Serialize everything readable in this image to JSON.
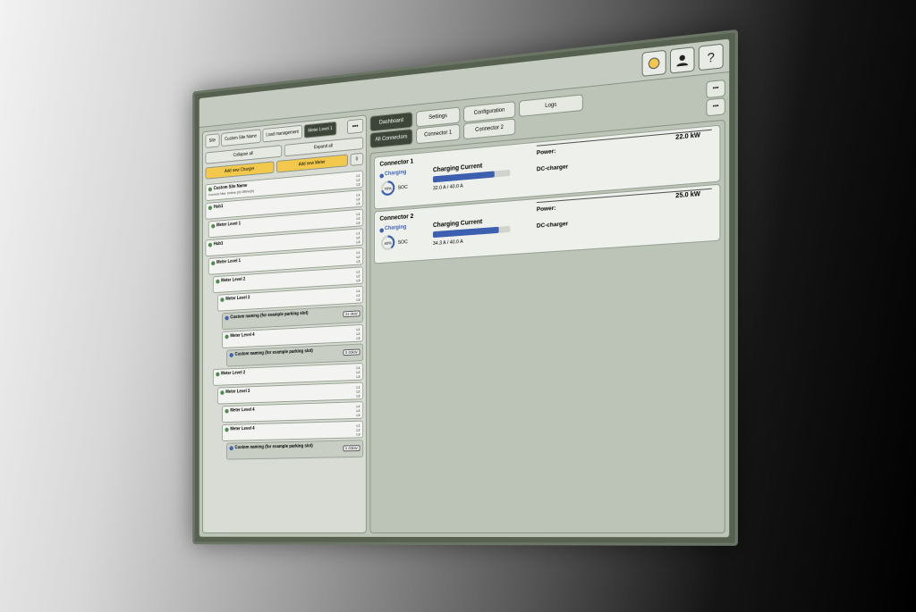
{
  "topbar": {
    "icons": [
      "charger-icon",
      "user-icon",
      "help-icon"
    ],
    "help_glyph": "?"
  },
  "left": {
    "crumbs": [
      "Site",
      "Custom Site Name",
      "Load management",
      "Meter Level 1"
    ],
    "actions": [
      "Collapse all",
      "Expand all"
    ],
    "add": [
      "Add new Charger",
      "Add new Meter"
    ],
    "count": "0",
    "nodes": [
      {
        "title": "Custom Site Name",
        "sub": "Connect Ntw. Online (0) Offline(0)",
        "phases": [
          "L1",
          "L2",
          "L3"
        ]
      },
      {
        "title": "Hub1",
        "phases": [
          "L1",
          "L2",
          "L3"
        ]
      },
      {
        "title": "Meter Level 1",
        "phases": [
          "L1",
          "L2",
          "L3"
        ]
      },
      {
        "title": "Hub1",
        "phases": [
          "L1",
          "L2",
          "L3"
        ]
      },
      {
        "title": "Meter Level 1",
        "phases": [
          "L1",
          "L2",
          "L3"
        ]
      },
      {
        "title": "Meter Level 2",
        "phases": [
          "L1",
          "L2",
          "L3"
        ]
      },
      {
        "title": "Meter Level 3",
        "phases": [
          "L1",
          "L2",
          "L3"
        ]
      },
      {
        "title": "Custom naming (for example parking slot)",
        "sub": "",
        "power": "22.0kW"
      },
      {
        "title": "Meter Level 4",
        "phases": [
          "L1",
          "L2",
          "L3"
        ]
      },
      {
        "title": "Custom naming (for example parking slot)",
        "sub": "",
        "power": "0.00kW"
      },
      {
        "title": "Meter Level 2",
        "phases": [
          "L1",
          "L2",
          "L3"
        ]
      },
      {
        "title": "Meter Level 3",
        "phases": [
          "L1",
          "L2",
          "L3"
        ]
      },
      {
        "title": "Meter Level 4",
        "phases": [
          "L1",
          "L2",
          "L3"
        ]
      },
      {
        "title": "Meter Level 4",
        "phases": [
          "L1",
          "L2",
          "L3"
        ]
      },
      {
        "title": "Custom naming (for example parking slot)",
        "sub": "",
        "power": "0.00kW"
      }
    ]
  },
  "tabs": {
    "dashboard": "Dashboard",
    "settings": "Settings",
    "configuration": "Configuration",
    "logs": "Logs",
    "all": "All Connectors",
    "c1": "Connector 1",
    "c2": "Connector 2"
  },
  "connectors": [
    {
      "name": "Connector 1",
      "status": "Charging",
      "soc": "70%",
      "soc_label": "SOC",
      "soc_fraction": 0.7,
      "cc_label": "Charging Current",
      "fill_fraction": 0.8,
      "amps": "32.0 A",
      "max": "40.0 A",
      "power_label": "Power:",
      "power": "22.0 kW",
      "type": "DC-charger"
    },
    {
      "name": "Connector 2",
      "status": "Charging",
      "soc": "40%",
      "soc_label": "SOC",
      "soc_fraction": 0.4,
      "cc_label": "Charging Current",
      "fill_fraction": 0.86,
      "amps": "34.3 A",
      "max": "40.0 A",
      "power_label": "Power:",
      "power": "25.0 kW",
      "type": "DC-charger"
    }
  ]
}
